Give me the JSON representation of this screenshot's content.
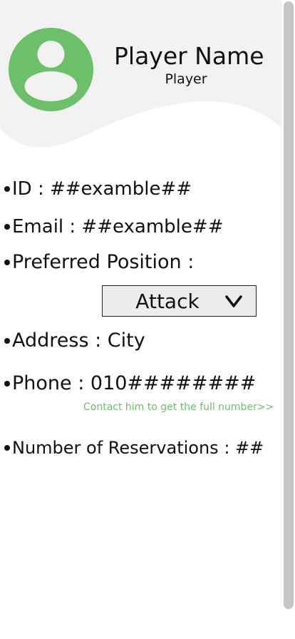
{
  "profile": {
    "name": "Player Name",
    "role": "Player",
    "avatar_icon": "user-avatar-icon",
    "avatar_color": "#6cc06a"
  },
  "details": {
    "id_label": "ID : ##examble##",
    "email_label": "Email : ##examble##",
    "position_label": "Preferred Position :",
    "position_value": "Attack",
    "address_label": "Address : City",
    "phone_label": "Phone :  010########",
    "contact_link": "Contact him to get the full number>>",
    "reservations_label": "Number of Reservations : ##"
  },
  "colors": {
    "accent": "#6cc06a",
    "header_background": "#f2f2f2",
    "dropdown_background": "#eeecea"
  }
}
